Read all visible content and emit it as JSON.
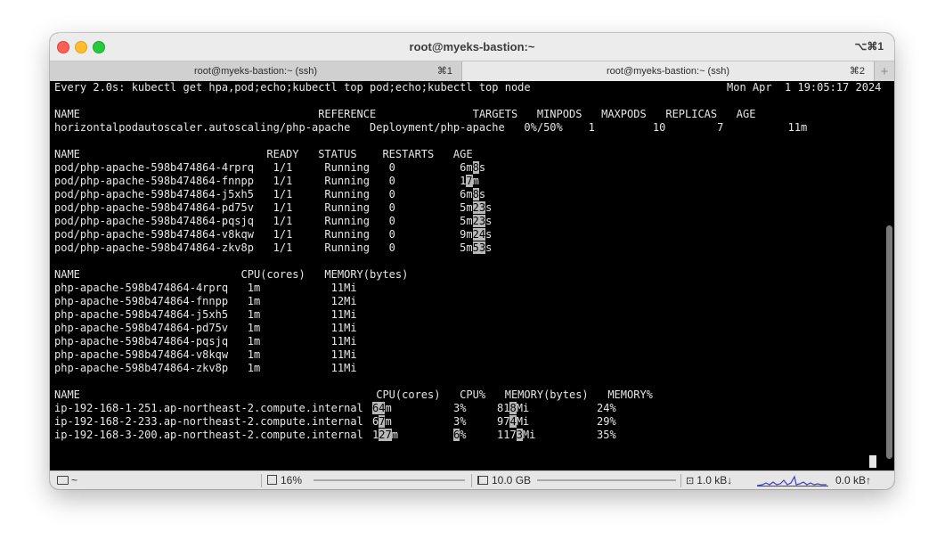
{
  "window": {
    "title": "root@myeks-bastion:~",
    "shortcut": "⌥⌘1"
  },
  "tabs": [
    {
      "label": "root@myeks-bastion:~ (ssh)",
      "shortcut": "⌘1"
    },
    {
      "label": "root@myeks-bastion:~ (ssh)",
      "shortcut": "⌘2"
    }
  ],
  "tab_add_label": "+",
  "terminal": {
    "header_cmd": "Every 2.0s: kubectl get hpa,pod;echo;kubectl top pod;echo;kubectl top node",
    "header_time": "Mon Apr  1 19:05:17 2024",
    "hpa": {
      "header": "NAME                                     REFERENCE               TARGETS   MINPODS   MAXPODS   REPLICAS   AGE",
      "row": "horizontalpodautoscaler.autoscaling/php-apache   Deployment/php-apache   0%/50%    1         10        7          11m"
    },
    "pods": {
      "header": "NAME                             READY   STATUS    RESTARTS   AGE",
      "rows": [
        {
          "pre": "pod/php-apache-598b474864-4rprq   1/1     Running   0          6m",
          "hl": "8",
          "post": "s"
        },
        {
          "pre": "pod/php-apache-598b474864-fnnpp   1/1     Running   0          1",
          "hl": "7",
          "post": "m"
        },
        {
          "pre": "pod/php-apache-598b474864-j5xh5   1/1     Running   0          6m",
          "hl": "8",
          "post": "s"
        },
        {
          "pre": "pod/php-apache-598b474864-pd75v   1/1     Running   0          5m",
          "hl": "23",
          "post": "s"
        },
        {
          "pre": "pod/php-apache-598b474864-pqsjq   1/1     Running   0          5m",
          "hl": "23",
          "post": "s"
        },
        {
          "pre": "pod/php-apache-598b474864-v8kqw   1/1     Running   0          9m",
          "hl": "24",
          "post": "s"
        },
        {
          "pre": "pod/php-apache-598b474864-zkv8p   1/1     Running   0          5m",
          "hl": "53",
          "post": "s"
        }
      ]
    },
    "top_pod": {
      "header": "NAME                         CPU(cores)   MEMORY(bytes)",
      "rows": [
        "php-apache-598b474864-4rprq   1m           11Mi",
        "php-apache-598b474864-fnnpp   1m           12Mi",
        "php-apache-598b474864-j5xh5   1m           11Mi",
        "php-apache-598b474864-pd75v   1m           11Mi",
        "php-apache-598b474864-pqsjq   1m           11Mi",
        "php-apache-598b474864-v8kqw   1m           11Mi",
        "php-apache-598b474864-zkv8p   1m           11Mi"
      ]
    },
    "top_node": {
      "header": "NAME                                              CPU(cores)   CPU%   MEMORY(bytes)   MEMORY%",
      "rows": [
        {
          "name": "ip-192-168-1-251.ap-northeast-2.compute.internal",
          "cpu_hl": "64",
          "cpu_post": "m",
          "cpu_pct_hl": "",
          "cpu_pct": "3%",
          "mem_pre": "81",
          "mem_hl": "8",
          "mem_post": "Mi",
          "mem_pct": "24%"
        },
        {
          "name": "ip-192-168-2-233.ap-northeast-2.compute.internal",
          "cpu_pre": "6",
          "cpu_hl": "7",
          "cpu_post": "m",
          "cpu_pct_hl": "",
          "cpu_pct": "3%",
          "mem_pre": "97",
          "mem_hl": "4",
          "mem_post": "Mi",
          "mem_pct": "29%"
        },
        {
          "name": "ip-192-168-3-200.ap-northeast-2.compute.internal",
          "cpu_pre": "1",
          "cpu_hl": "27",
          "cpu_post": "m",
          "cpu_pct_hl": "6",
          "cpu_pct": "%",
          "mem_pre": "117",
          "mem_hl": "3",
          "mem_post": "Mi",
          "mem_pct": "35%"
        }
      ]
    }
  },
  "statusbar": {
    "dir": "~",
    "cpu": "16%",
    "memory": "10.0 GB",
    "net_down": "1.0 kB↓",
    "net_up": "0.0 kB↑"
  }
}
